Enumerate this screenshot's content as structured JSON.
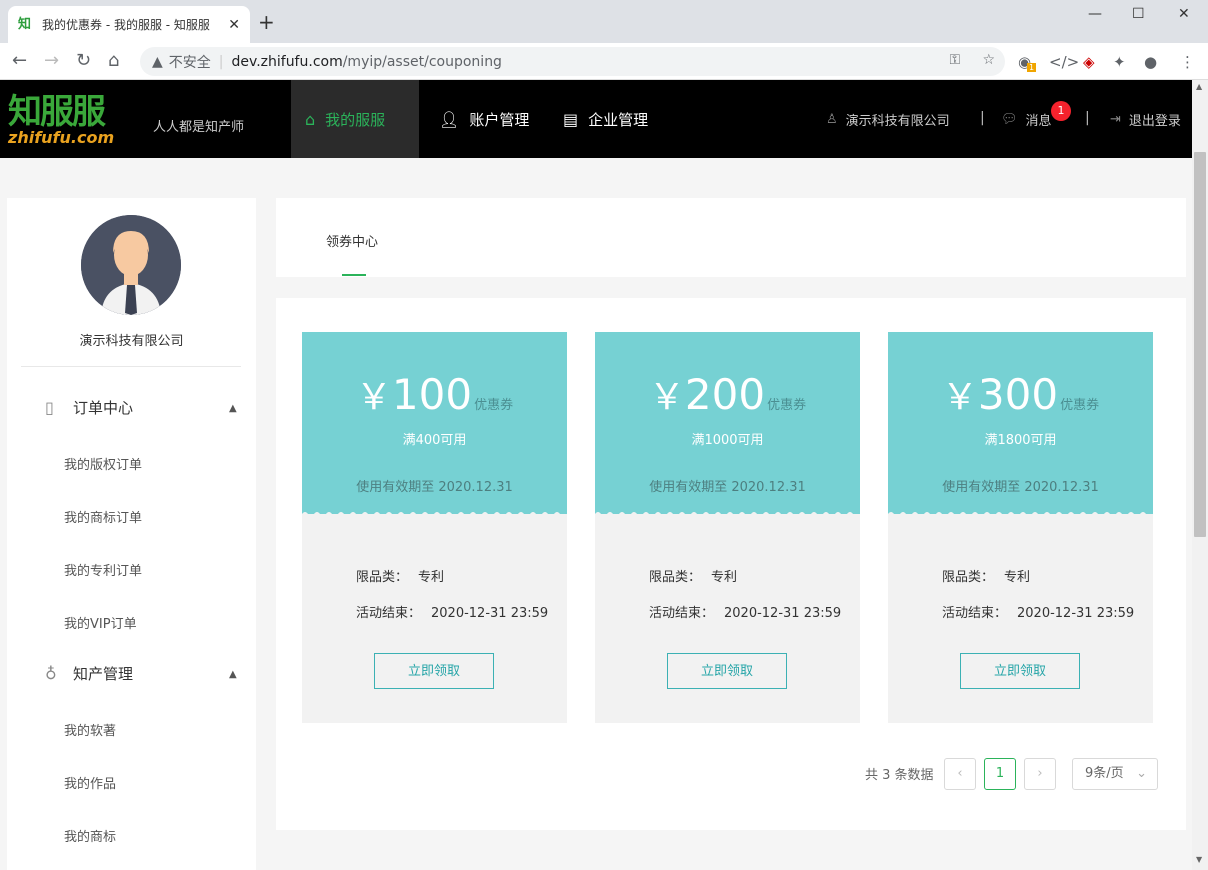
{
  "browser": {
    "tab_title": "我的优惠券 - 我的服服 - 知服服",
    "favicon_text": "知",
    "address_warning": "不安全",
    "url_host": "dev.zhifufu.com",
    "url_path": "/myip/asset/couponing",
    "ext_badge": "1"
  },
  "header": {
    "logo_cn": "知服服",
    "logo_en": "zhifufu.com",
    "slogan": "人人都是知产师",
    "nav": [
      {
        "label": "我的服服",
        "icon": "home-icon"
      },
      {
        "label": "账户管理",
        "icon": "user-icon"
      },
      {
        "label": "企业管理",
        "icon": "building-icon"
      }
    ],
    "company": "演示科技有限公司",
    "messages_label": "消息",
    "messages_badge": "1",
    "logout_label": "退出登录",
    "separator": "|"
  },
  "sidebar": {
    "company": "演示科技有限公司",
    "groups": [
      {
        "label": "订单中心",
        "icon": "document-icon",
        "items": [
          "我的版权订单",
          "我的商标订单",
          "我的专利订单",
          "我的VIP订单"
        ]
      },
      {
        "label": "知产管理",
        "icon": "lightbulb-icon",
        "items": [
          "我的软著",
          "我的作品",
          "我的商标"
        ]
      }
    ]
  },
  "content": {
    "tab_label": "领券中心",
    "coupons": [
      {
        "currency": "￥",
        "amount": "100",
        "tag": "优惠券",
        "condition": "满400可用",
        "valid": "使用有效期至 2020.12.31",
        "limit_label": "限品类：",
        "limit_value": "专利",
        "end_label": "活动结束：",
        "end_value": "2020-12-31 23:59",
        "button": "立即领取"
      },
      {
        "currency": "￥",
        "amount": "200",
        "tag": "优惠券",
        "condition": "满1000可用",
        "valid": "使用有效期至 2020.12.31",
        "limit_label": "限品类：",
        "limit_value": "专利",
        "end_label": "活动结束：",
        "end_value": "2020-12-31 23:59",
        "button": "立即领取"
      },
      {
        "currency": "￥",
        "amount": "300",
        "tag": "优惠券",
        "condition": "满1800可用",
        "valid": "使用有效期至 2020.12.31",
        "limit_label": "限品类：",
        "limit_value": "专利",
        "end_label": "活动结束：",
        "end_value": "2020-12-31 23:59",
        "button": "立即领取"
      }
    ],
    "pagination": {
      "total_text": "共 3 条数据",
      "prev": "‹",
      "current": "1",
      "next": "›",
      "page_size": "9条/页"
    }
  },
  "colors": {
    "accent": "#2bb35a",
    "coupon_top": "#76d1d3",
    "coupon_bottom": "#f2f2f2",
    "header_bg": "#000000"
  }
}
